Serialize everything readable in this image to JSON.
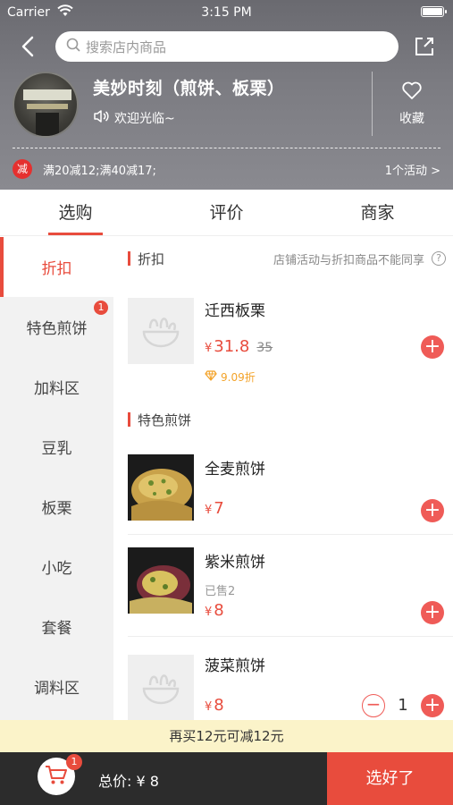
{
  "status": {
    "carrier": "Carrier",
    "time": "3:15 PM"
  },
  "search": {
    "placeholder": "搜索店内商品"
  },
  "shop": {
    "name": "美妙时刻（煎饼、板栗）",
    "welcome": "欢迎光临~",
    "favorite_label": "收藏",
    "promo_badge": "减",
    "promo_text": "满20减12;满40减17;",
    "activity_text": "1个活动 >"
  },
  "tabs": [
    {
      "label": "选购",
      "active": true
    },
    {
      "label": "评价",
      "active": false
    },
    {
      "label": "商家",
      "active": false
    }
  ],
  "categories": [
    {
      "label": "折扣",
      "active": true
    },
    {
      "label": "特色煎饼",
      "badge": "1"
    },
    {
      "label": "加料区"
    },
    {
      "label": "豆乳"
    },
    {
      "label": "板栗"
    },
    {
      "label": "小吃"
    },
    {
      "label": "套餐"
    },
    {
      "label": "调料区"
    }
  ],
  "sections": {
    "discount": {
      "title": "折扣",
      "note": "店铺活动与折扣商品不能同享",
      "help": "?"
    },
    "special": {
      "title": "特色煎饼"
    }
  },
  "items": [
    {
      "name": "迁西板栗",
      "currency": "¥",
      "price": "31.8",
      "old_price": "35",
      "discount": "9.09折"
    },
    {
      "name": "全麦煎饼",
      "currency": "¥",
      "price": "7"
    },
    {
      "name": "紫米煎饼",
      "sold": "已售2",
      "currency": "¥",
      "price": "8"
    },
    {
      "name": "菠菜煎饼",
      "currency": "¥",
      "price": "8",
      "quantity": "1"
    }
  ],
  "controls": {
    "add": "+",
    "minus": "−"
  },
  "cart": {
    "tip": "再买12元可减12元",
    "badge": "1",
    "total": "总价: ¥ 8",
    "checkout": "选好了"
  },
  "colors": {
    "accent": "#e84c3d",
    "tip_bg": "#fbf3c9",
    "bottom_bg": "#2c2c2c"
  }
}
